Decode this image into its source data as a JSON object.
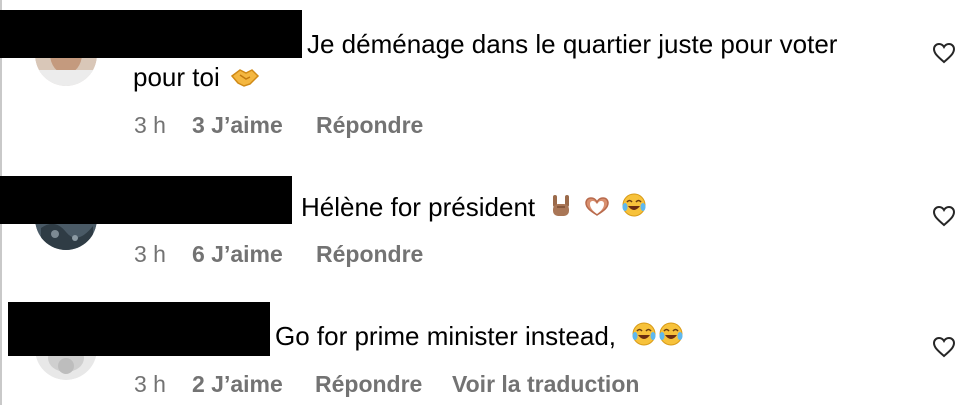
{
  "comments": [
    {
      "text_line1": "Je déménage dans le quartier juste pour voter",
      "text_line2": "pour toi",
      "time": "3 h",
      "likes": "3 J’aime",
      "reply": "Répondre",
      "emoji": [
        "handshake-emoji"
      ]
    },
    {
      "text_line1": "Hélène for président",
      "time": "3 h",
      "likes": "6 J’aime",
      "reply": "Répondre",
      "emoji": [
        "rock-on-hand-emoji",
        "heart-hands-emoji",
        "tears-of-joy-emoji"
      ]
    },
    {
      "text_line1": "Go for prime minister instead,",
      "time": "3 h",
      "likes": "2 J’aime",
      "reply": "Répondre",
      "translate": "Voir la traduction",
      "emoji": [
        "tears-of-joy-emoji",
        "tears-of-joy-emoji"
      ]
    }
  ],
  "icons": {
    "like": "heart-outline-icon"
  }
}
